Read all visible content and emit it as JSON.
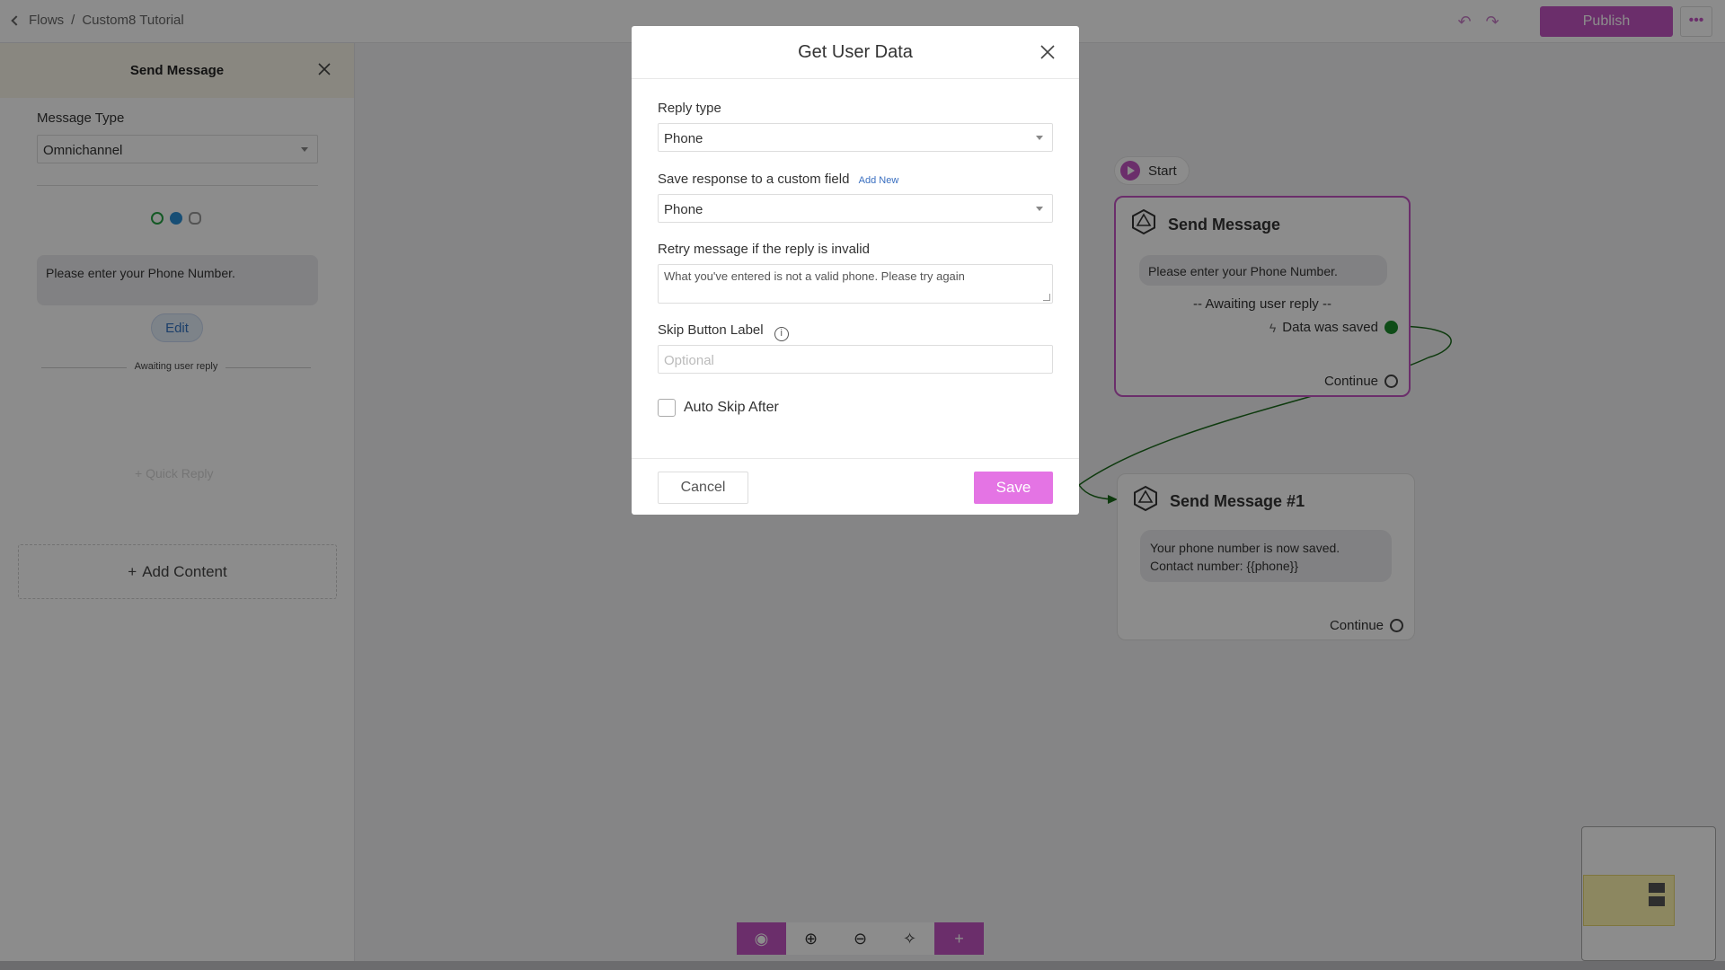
{
  "topbar": {
    "breadcrumb_root": "Flows",
    "breadcrumb_sep": "/",
    "breadcrumb_current": "Custom8 Tutorial",
    "publish_label": "Publish",
    "more_label": "•••"
  },
  "left_panel": {
    "title": "Send Message",
    "message_type_label": "Message Type",
    "message_type_value": "Omnichannel",
    "bubble_text": "Please enter your Phone Number.",
    "edit_label": "Edit",
    "awaiting_label": "Awaiting user reply",
    "quick_reply_label": "+ Quick Reply",
    "add_content_label": "Add Content"
  },
  "canvas": {
    "start_label": "Start",
    "node1": {
      "title": "Send Message",
      "bubble": "Please enter your Phone Number.",
      "awaiting": "-- Awaiting user reply --",
      "saved": "Data was saved",
      "continue": "Continue"
    },
    "node2": {
      "title": "Send Message #1",
      "bubble_line1": "Your phone number is now saved.",
      "bubble_line2": "Contact number: {{phone}}",
      "continue": "Continue"
    }
  },
  "modal": {
    "title": "Get User Data",
    "reply_type_label": "Reply type",
    "reply_type_value": "Phone",
    "save_field_label": "Save response to a custom field",
    "add_new_label": "Add New",
    "save_field_value": "Phone",
    "retry_label": "Retry message if the reply is invalid",
    "retry_value": "What you've entered is not a valid phone. Please try again",
    "skip_label": "Skip Button Label",
    "skip_placeholder": "Optional",
    "auto_skip_label": "Auto Skip After",
    "cancel_label": "Cancel",
    "save_label": "Save"
  },
  "colors": {
    "accent": "#c354c3",
    "save_button": "#e474e4",
    "connection": "#1a6a1a"
  }
}
